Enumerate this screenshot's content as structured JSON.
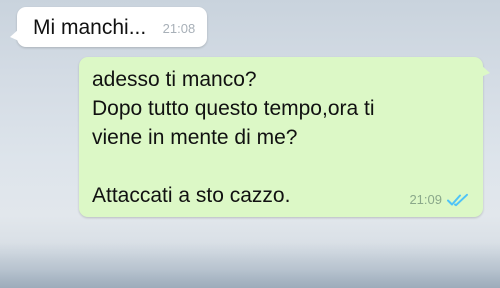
{
  "colors": {
    "incoming_bubble": "#ffffff",
    "outgoing_bubble": "#dcf8c6",
    "read_ticks": "#4fc3f7"
  },
  "messages": [
    {
      "direction": "incoming",
      "text": "Mi manchi...",
      "time": "21:08"
    },
    {
      "direction": "outgoing",
      "lines": [
        "adesso ti manco?",
        "Dopo tutto questo tempo,ora ti",
        "viene in mente di me?",
        "",
        "Attaccati a sto cazzo."
      ],
      "time": "21:09",
      "status_icon": "double-check-read-icon"
    }
  ]
}
